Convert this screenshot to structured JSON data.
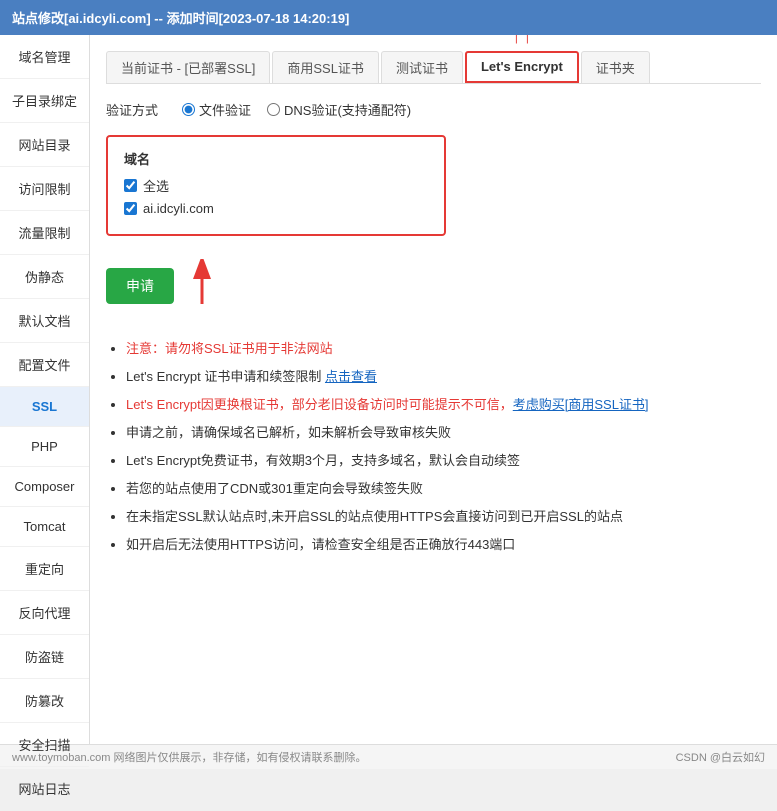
{
  "titleBar": {
    "text": "站点修改[ai.idcyli.com] -- 添加时间[2023-07-18 14:20:19]"
  },
  "sidebar": {
    "items": [
      {
        "id": "domain-mgmt",
        "label": "域名管理"
      },
      {
        "id": "subdir-bind",
        "label": "子目录绑定"
      },
      {
        "id": "website-dir",
        "label": "网站目录"
      },
      {
        "id": "access-limit",
        "label": "访问限制"
      },
      {
        "id": "traffic-limit",
        "label": "流量限制"
      },
      {
        "id": "pseudo-static",
        "label": "伪静态"
      },
      {
        "id": "default-doc",
        "label": "默认文档"
      },
      {
        "id": "config-file",
        "label": "配置文件"
      },
      {
        "id": "ssl",
        "label": "SSL",
        "active": true
      },
      {
        "id": "php",
        "label": "PHP"
      },
      {
        "id": "composer",
        "label": "Composer"
      },
      {
        "id": "tomcat",
        "label": "Tomcat"
      },
      {
        "id": "redirect",
        "label": "重定向"
      },
      {
        "id": "reverse-proxy",
        "label": "反向代理"
      },
      {
        "id": "hotlink",
        "label": "防盗链"
      },
      {
        "id": "anti-tamper",
        "label": "防篡改"
      },
      {
        "id": "security-scan",
        "label": "安全扫描"
      },
      {
        "id": "site-log",
        "label": "网站日志"
      }
    ]
  },
  "tabs": [
    {
      "id": "current-cert",
      "label": "当前证书 - [已部署SSL]",
      "active": false
    },
    {
      "id": "commercial-ssl",
      "label": "商用SSL证书",
      "active": false
    },
    {
      "id": "test-cert",
      "label": "测试证书",
      "active": false
    },
    {
      "id": "lets-encrypt",
      "label": "Let's Encrypt",
      "active": true,
      "highlighted": true
    },
    {
      "id": "cert-folder",
      "label": "证书夹",
      "active": false
    }
  ],
  "verifyMethod": {
    "label": "验证方式",
    "options": [
      {
        "id": "file-verify",
        "label": "文件验证",
        "checked": true
      },
      {
        "id": "dns-verify",
        "label": "DNS验证(支持通配符)",
        "checked": false
      }
    ]
  },
  "domainBox": {
    "label": "域名",
    "items": [
      {
        "id": "select-all",
        "label": "全选",
        "checked": true
      },
      {
        "id": "domain-1",
        "label": "ai.idcyli.com",
        "checked": true
      }
    ]
  },
  "applyButton": {
    "label": "申请"
  },
  "notes": [
    {
      "id": "note-1",
      "text": "注意：请勿将SSL证书用于非法网站",
      "type": "red"
    },
    {
      "id": "note-2",
      "text": "Let's Encrypt 证书申请和续签限制 ",
      "link": "点击查看",
      "type": "normal"
    },
    {
      "id": "note-3",
      "text": "Let's Encrypt因更换根证书，部分老旧设备访问时可能提示不可信，",
      "linkText": "考虑购买[商用SSL证书]",
      "type": "red-link"
    },
    {
      "id": "note-4",
      "text": "申请之前，请确保域名已解析，如未解析会导致审核失败",
      "type": "normal"
    },
    {
      "id": "note-5",
      "text": "Let's Encrypt免费证书，有效期3个月，支持多域名，默认会自动续签",
      "type": "normal"
    },
    {
      "id": "note-6",
      "text": "若您的站点使用了CDN或301重定向会导致续签失败",
      "type": "normal"
    },
    {
      "id": "note-7",
      "text": "在未指定SSL默认站点时,未开启SSL的站点使用HTTPS会直接访问到已开启SSL的站点",
      "type": "normal"
    },
    {
      "id": "note-8",
      "text": "如开启后无法使用HTTPS访问，请检查安全组是否正确放行443端口",
      "type": "normal"
    }
  ],
  "footer": {
    "left": "www.toymoban.com 网络图片仅供展示，非存储，如有侵权请联系删除。",
    "right": "CSDN @白云如幻"
  }
}
